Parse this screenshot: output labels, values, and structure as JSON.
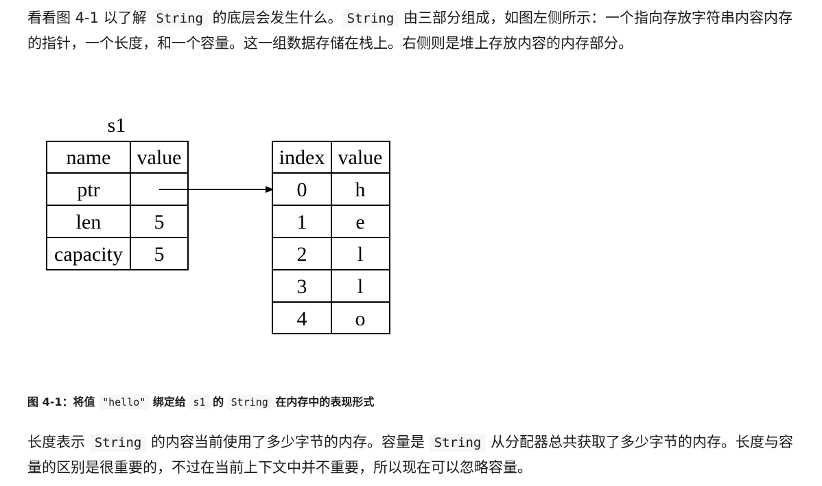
{
  "para1": {
    "t1": "看看图 4-1 以了解 ",
    "code1": "String",
    "t2": " 的底层会发生什么。",
    "code2": "String",
    "t3": " 由三部分组成，如图左侧所示：一个指向存放字符串内容内存的指针，一个长度，和一个容量。这一组数据存储在栈上。右侧则是堆上存放内容的内存部分。"
  },
  "figure": {
    "stack_title": "s1",
    "stack_headers": [
      "name",
      "value"
    ],
    "stack_rows": [
      {
        "name": "ptr",
        "value": ""
      },
      {
        "name": "len",
        "value": "5"
      },
      {
        "name": "capacity",
        "value": "5"
      }
    ],
    "heap_headers": [
      "index",
      "value"
    ],
    "heap_rows": [
      {
        "index": "0",
        "value": "h"
      },
      {
        "index": "1",
        "value": "e"
      },
      {
        "index": "2",
        "value": "l"
      },
      {
        "index": "3",
        "value": "l"
      },
      {
        "index": "4",
        "value": "o"
      }
    ]
  },
  "caption": {
    "t1": "图 4-1：将值 ",
    "code1": "\"hello\"",
    "t2": " 绑定给 ",
    "code2": "s1",
    "t3": " 的 ",
    "code3": "String",
    "t4": " 在内存中的表现形式"
  },
  "para2": {
    "t1": "长度表示 ",
    "code1": "String",
    "t2": " 的内容当前使用了多少字节的内存。容量是 ",
    "code2": "String",
    "t3": " 从分配器总共获取了多少字节的内存。长度与容量的区别是很重要的，不过在当前上下文中并不重要，所以现在可以忽略容量。"
  }
}
